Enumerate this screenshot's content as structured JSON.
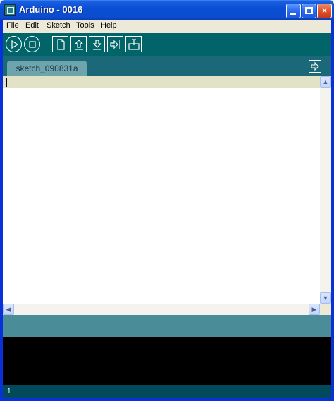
{
  "window": {
    "title": "Arduino - 0016",
    "controls": {
      "minimize": "minimize",
      "maximize": "maximize",
      "close": "×"
    }
  },
  "menubar": {
    "items": [
      "File",
      "Edit",
      "Sketch",
      "Tools",
      "Help"
    ]
  },
  "toolbar": {
    "buttons": [
      "verify",
      "stop",
      "new",
      "open",
      "save",
      "upload",
      "serial-monitor"
    ]
  },
  "tabs": {
    "items": [
      {
        "label": "sketch_090831a"
      }
    ]
  },
  "editor": {
    "content": ""
  },
  "scrollbars": {
    "up_arrow": "▲",
    "down_arrow": "▼",
    "left_arrow": "◀",
    "right_arrow": "▶"
  },
  "status": {
    "line_number": "1"
  },
  "colors": {
    "toolbar": "#006468",
    "tabstrip": "#1a6878",
    "tab": "#6ea4ab",
    "line_highlight": "#e2e2c6",
    "message_area": "#4b8c99",
    "console": "#000000",
    "status_bar": "#004a5c"
  }
}
